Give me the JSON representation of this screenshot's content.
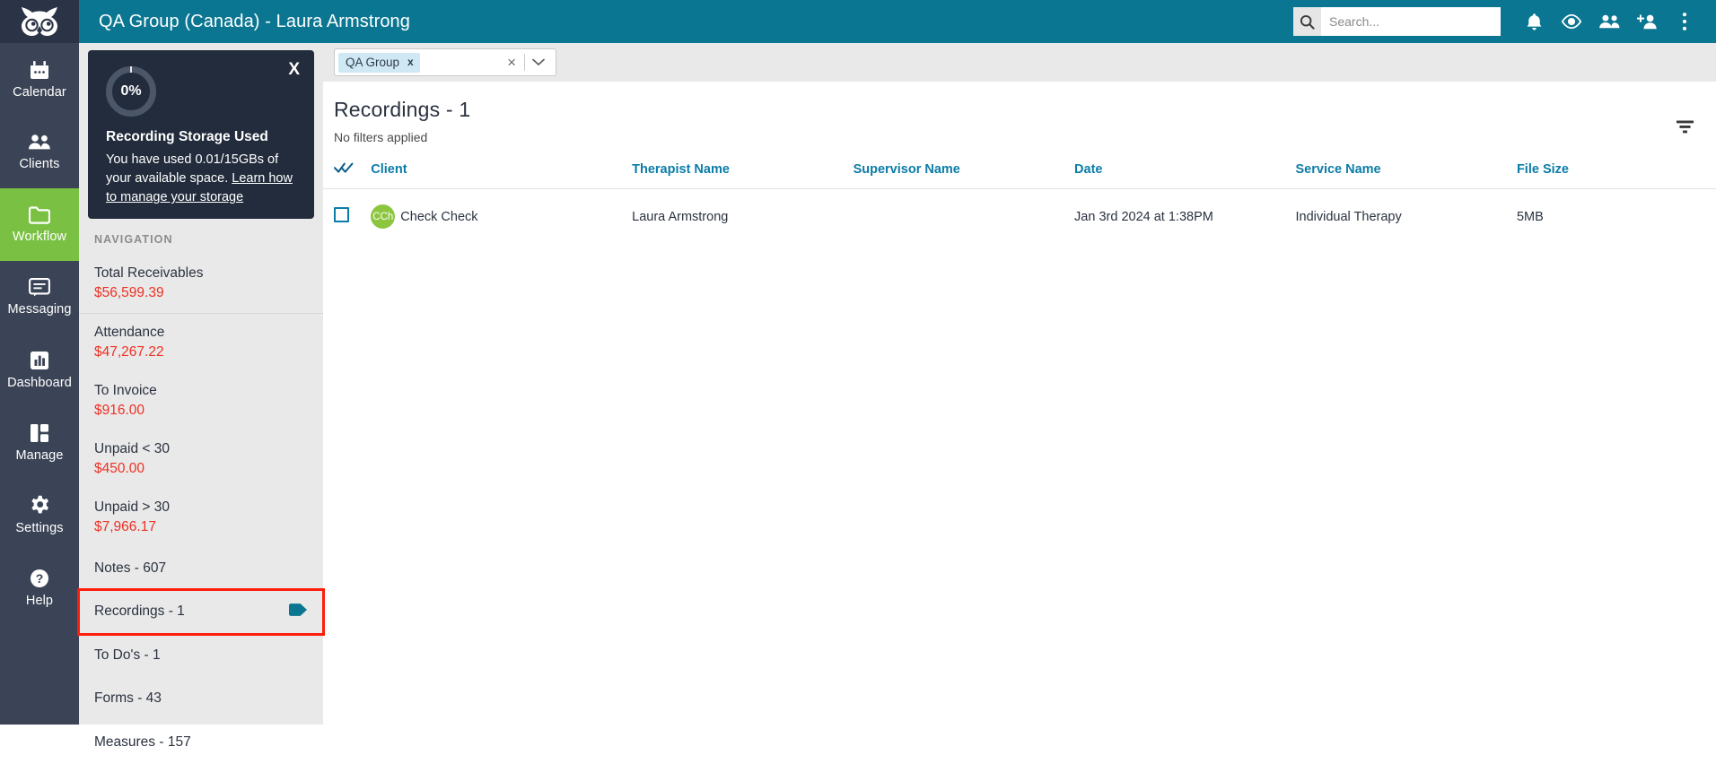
{
  "header": {
    "title": "QA Group (Canada) - Laura Armstrong",
    "logo_icon": "owl-logo-icon",
    "brand_color": "#0b7691",
    "search": {
      "placeholder": "Search...",
      "value": "",
      "icon": "search-icon"
    },
    "icons": [
      {
        "name": "notifications-bell-icon",
        "glyph": "bell"
      },
      {
        "name": "eye-icon",
        "glyph": "eye"
      },
      {
        "name": "clients-group-icon",
        "glyph": "people"
      },
      {
        "name": "add-person-icon",
        "glyph": "person-plus"
      },
      {
        "name": "overflow-menu-icon",
        "glyph": "kebab"
      }
    ]
  },
  "rail": {
    "active_color": "#7ac143",
    "items": [
      {
        "label": "Calendar",
        "icon": "calendar-icon",
        "active": false
      },
      {
        "label": "Clients",
        "icon": "clients-icon",
        "active": false
      },
      {
        "label": "Workflow",
        "icon": "folder-icon",
        "active": true
      },
      {
        "label": "Messaging",
        "icon": "message-icon",
        "active": false
      },
      {
        "label": "Dashboard",
        "icon": "chart-bar-icon",
        "active": false
      },
      {
        "label": "Manage",
        "icon": "layout-icon",
        "active": false
      },
      {
        "label": "Settings",
        "icon": "gear-icon",
        "active": false
      },
      {
        "label": "Help",
        "icon": "help-circle-icon",
        "active": false
      }
    ]
  },
  "storage_card": {
    "percent": "0%",
    "title": "Recording Storage Used",
    "text_before_link": "You have used 0.01/15GBs of your available space. ",
    "link_text": "Learn how to manage your storage",
    "close_label": "X"
  },
  "nav": {
    "section_title": "NAVIGATION",
    "items": [
      {
        "label": "Total Receivables",
        "value": "$56,599.39",
        "divided": false,
        "type": "amount"
      },
      {
        "label": "Attendance",
        "value": "$47,267.22",
        "divided": true,
        "type": "amount"
      },
      {
        "label": "To Invoice",
        "value": "$916.00",
        "divided": false,
        "type": "amount"
      },
      {
        "label": "Unpaid < 30",
        "value": "$450.00",
        "divided": false,
        "type": "amount"
      },
      {
        "label": "Unpaid > 30",
        "value": "$7,966.17",
        "divided": false,
        "type": "amount"
      },
      {
        "label": "Notes - 607",
        "value": "",
        "divided": false,
        "type": "simple"
      },
      {
        "label": "Recordings - 1",
        "value": "",
        "divided": false,
        "type": "simple",
        "highlighted": true,
        "tag_icon": "tag-icon",
        "tag_color": "#0b7691"
      },
      {
        "label": "To Do's - 1",
        "value": "",
        "divided": false,
        "type": "simple"
      },
      {
        "label": "Forms - 43",
        "value": "",
        "divided": false,
        "type": "simple"
      },
      {
        "label": "Measures - 157",
        "value": "",
        "divided": false,
        "type": "simple"
      }
    ],
    "value_color": "#ee3124",
    "highlight_color": "#fc1d0d"
  },
  "filter_bar": {
    "chip_label": "QA Group",
    "chip_remove": "x",
    "clear_label": "×",
    "caret_icon": "chevron-down-icon"
  },
  "main": {
    "page_title": "Recordings - 1",
    "page_subtitle": "No filters applied",
    "filter_icon": "filter-funnel-icon",
    "table": {
      "select_all_icon": "double-check-icon",
      "columns": [
        "Client",
        "Therapist Name",
        "Supervisor Name",
        "Date",
        "Service Name",
        "File Size"
      ],
      "rows": [
        {
          "checked": false,
          "avatar_initials": "CCh",
          "avatar_color": "#8cc63e",
          "client": "Check Check",
          "therapist": "Laura Armstrong",
          "supervisor": "",
          "date": "Jan 3rd 2024 at 1:38PM",
          "service": "Individual Therapy",
          "file_size": "5MB"
        }
      ]
    }
  }
}
